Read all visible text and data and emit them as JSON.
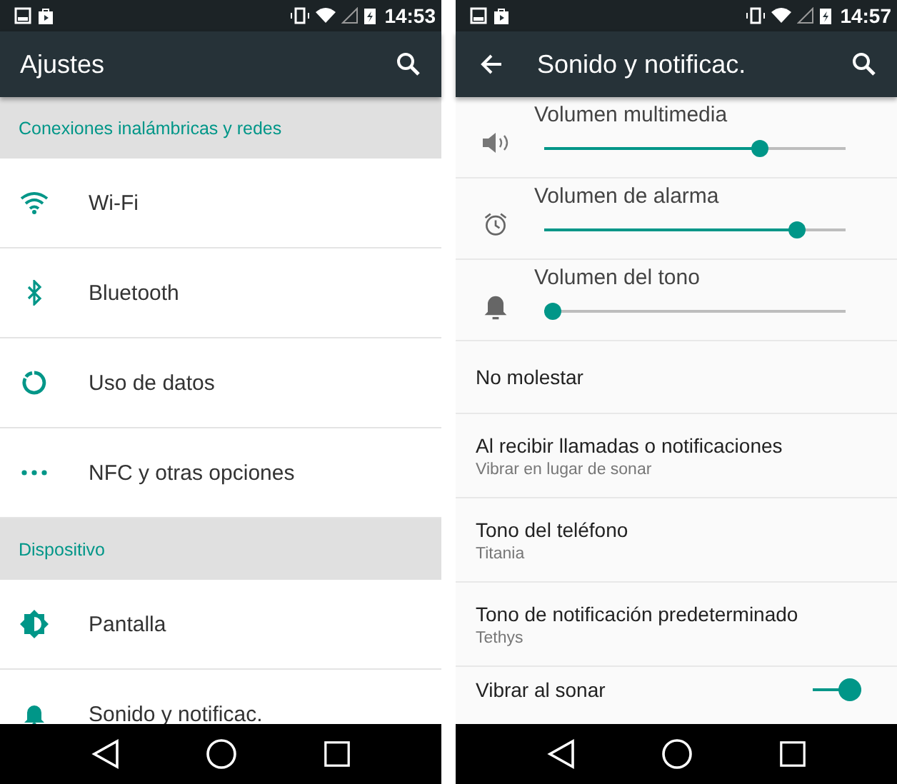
{
  "screens": [
    {
      "status_bar": {
        "time": "14:53"
      },
      "toolbar": {
        "title": "Ajustes",
        "back": false
      },
      "items": [
        {
          "kind": "header",
          "title": "Conexiones inalámbricas y redes"
        },
        {
          "kind": "entry",
          "title": "Wi-Fi"
        },
        {
          "kind": "entry",
          "title": "Bluetooth"
        },
        {
          "kind": "entry",
          "title": "Uso de datos"
        },
        {
          "kind": "entry",
          "title": "NFC y otras opciones"
        },
        {
          "kind": "header",
          "title": "Dispositivo"
        },
        {
          "kind": "entry",
          "title": "Pantalla"
        },
        {
          "kind": "entry",
          "title": "Sonido y notificac."
        }
      ]
    },
    {
      "status_bar": {
        "time": "14:57"
      },
      "toolbar": {
        "title": "Sonido y notificac.",
        "back": true
      },
      "items": [
        {
          "kind": "slider",
          "title": "Volumen multimedia",
          "level": 0.73
        },
        {
          "kind": "slider",
          "title": "Volumen de alarma",
          "level": 0.86
        },
        {
          "kind": "slider",
          "title": "Volumen del tono",
          "level": 0
        },
        {
          "kind": "text",
          "title": "No molestar"
        },
        {
          "kind": "text",
          "title": "Al recibir llamadas o notificaciones",
          "subtitle": "Vibrar en lugar de sonar"
        },
        {
          "kind": "text",
          "title": "Tono del teléfono",
          "subtitle": "Titania"
        },
        {
          "kind": "text",
          "title": "Tono de notificación predeterminado",
          "subtitle": "Tethys"
        },
        {
          "kind": "toggle",
          "title": "Vibrar al sonar",
          "on": true
        }
      ]
    }
  ]
}
